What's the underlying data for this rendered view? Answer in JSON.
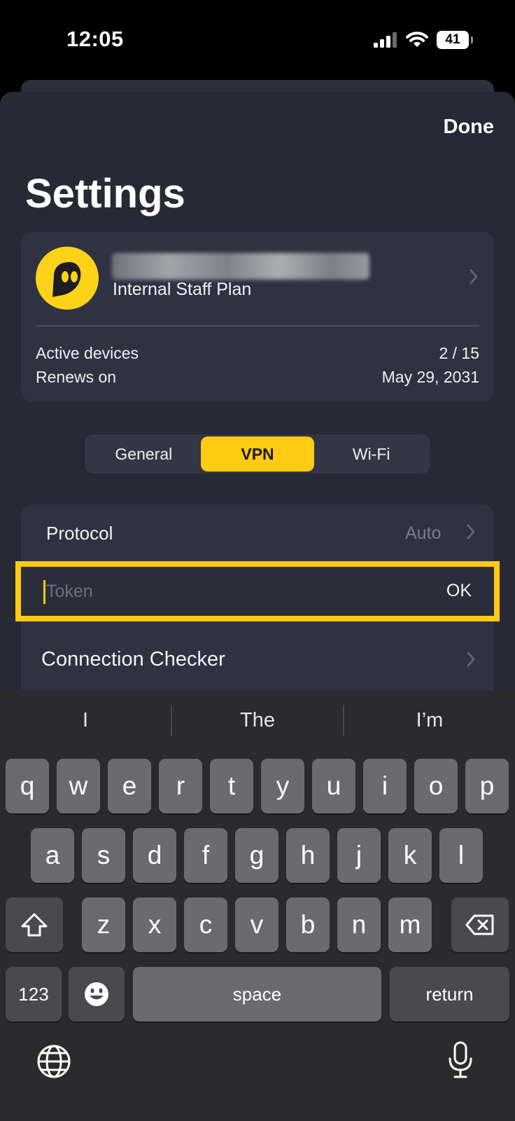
{
  "status_bar": {
    "time": "12:05",
    "battery": "41"
  },
  "header": {
    "done_label": "Done",
    "title": "Settings"
  },
  "account": {
    "plan": "Internal Staff Plan",
    "rows": [
      {
        "label": "Active devices",
        "value": "2 / 15"
      },
      {
        "label": "Renews on",
        "value": "May 29, 2031"
      }
    ]
  },
  "tabs": {
    "items": [
      "General",
      "VPN",
      "Wi-Fi"
    ],
    "active": "VPN"
  },
  "vpn_settings": {
    "protocol_label": "Protocol",
    "protocol_value": "Auto",
    "token_placeholder": "Token",
    "token_value": "",
    "ok_label": "OK",
    "connection_checker_label": "Connection Checker"
  },
  "keyboard": {
    "suggestions": [
      "I",
      "The",
      "I’m"
    ],
    "row1": [
      "q",
      "w",
      "e",
      "r",
      "t",
      "y",
      "u",
      "i",
      "o",
      "p"
    ],
    "row2": [
      "a",
      "s",
      "d",
      "f",
      "g",
      "h",
      "j",
      "k",
      "l"
    ],
    "row3": [
      "z",
      "x",
      "c",
      "v",
      "b",
      "n",
      "m"
    ],
    "numbers_label": "123",
    "space_label": "space",
    "return_label": "return"
  },
  "icons": {
    "signal": "cellular-signal-icon",
    "wifi": "wifi-icon",
    "battery": "battery-icon",
    "avatar": "ghost-logo-icon",
    "chevron": "chevron-right-icon",
    "shift": "shift-icon",
    "delete": "backspace-icon",
    "emoji": "emoji-icon",
    "globe": "globe-icon",
    "mic": "microphone-icon"
  },
  "colors": {
    "accent": "#FFCB14",
    "background": "#272935",
    "card": "#2F3240"
  }
}
